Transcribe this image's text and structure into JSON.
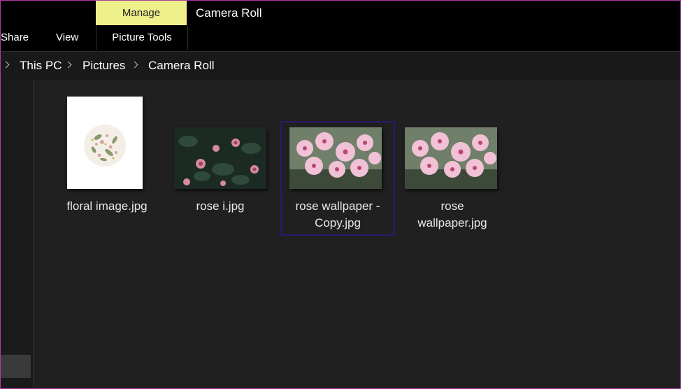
{
  "titlebar": {
    "manage_label": "Manage",
    "window_title": "Camera Roll"
  },
  "ribbon": {
    "tabs": [
      "Share",
      "View",
      "Picture Tools"
    ]
  },
  "address": {
    "crumbs": [
      "This PC",
      "Pictures",
      "Camera Roll"
    ]
  },
  "files": [
    {
      "name": "floral image.jpg",
      "icon": "floral-image-thumbnail"
    },
    {
      "name": "rose i.jpg",
      "icon": "dark-rose-thumbnail"
    },
    {
      "name_line1": "rose wallpaper -",
      "name_line2": "Copy.jpg",
      "icon": "pink-blossom-thumbnail",
      "selected": true
    },
    {
      "name_line1": "rose",
      "name_line2": "wallpaper.jpg",
      "icon": "pink-blossom-thumbnail"
    }
  ],
  "colors": {
    "manage_tab": "#eef08a",
    "selection_border": "#2a1a6e",
    "window_border": "#b03aa0"
  }
}
